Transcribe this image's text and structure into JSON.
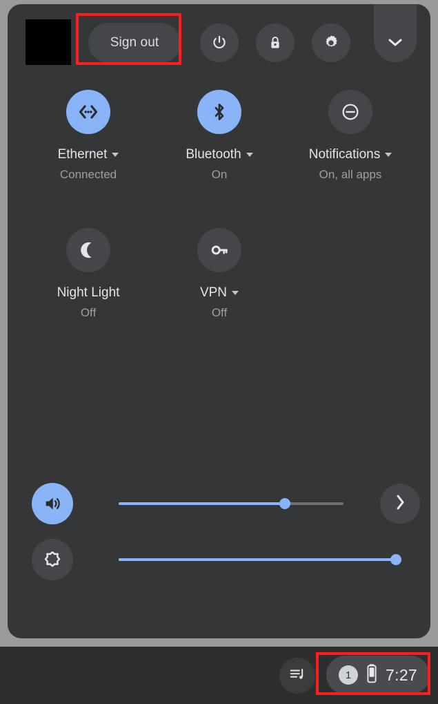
{
  "panel": {
    "header": {
      "avatar_label": "user-avatar",
      "sign_out_label": "Sign out",
      "power_icon": "power-icon",
      "lock_icon": "lock-icon",
      "settings_icon": "gear-icon",
      "collapse_icon": "chevron-down-icon"
    },
    "tiles": [
      {
        "label": "Ethernet",
        "state": "Connected",
        "icon": "ethernet-icon",
        "active": true,
        "has_dropdown": true
      },
      {
        "label": "Bluetooth",
        "state": "On",
        "icon": "bluetooth-icon",
        "active": true,
        "has_dropdown": true
      },
      {
        "label": "Notifications",
        "state": "On, all apps",
        "icon": "do-not-disturb-icon",
        "active": false,
        "has_dropdown": true
      },
      {
        "label": "Night Light",
        "state": "Off",
        "icon": "moon-icon",
        "active": false,
        "has_dropdown": false
      },
      {
        "label": "VPN",
        "state": "Off",
        "icon": "key-icon",
        "active": false,
        "has_dropdown": true
      }
    ],
    "sliders": {
      "volume": {
        "icon": "volume-icon",
        "active": true,
        "percent": 74,
        "expand_icon": "chevron-right-icon"
      },
      "brightness": {
        "icon": "brightness-icon",
        "active": false,
        "percent": 100
      }
    }
  },
  "shelf": {
    "media_icon": "media-playlist-icon",
    "status_tray": {
      "notification_count": "1",
      "battery_icon": "battery-icon",
      "time": "7:27"
    }
  },
  "annotations": {
    "accent_color": "#ff1d1d",
    "highlighted": [
      "sign-out-button",
      "status-tray"
    ]
  },
  "theme": {
    "panel_bg": "#353638",
    "control_bg": "#45464a",
    "accent_blue": "#8ab4f8",
    "shelf_bg": "#2d2e30",
    "desktop_bg": "#9a9a9a",
    "text_primary": "#e3e5e8",
    "text_secondary": "#9aa0a6"
  }
}
